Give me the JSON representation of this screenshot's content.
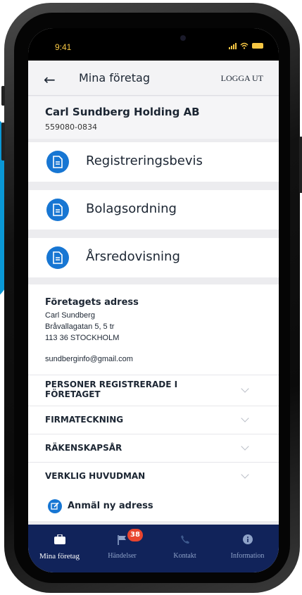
{
  "status_bar": {
    "time": "9:41"
  },
  "header": {
    "title": "Mina företag",
    "logout_label": "LOGGA UT"
  },
  "company": {
    "name": "Carl Sundberg Holding AB",
    "org_number": "559080-0834"
  },
  "documents": [
    {
      "label": "Registreringsbevis",
      "icon": "document-icon"
    },
    {
      "label": "Bolagsordning",
      "icon": "document-icon"
    },
    {
      "label": "Årsredovisning",
      "icon": "document-icon"
    }
  ],
  "address": {
    "heading": "Företagets adress",
    "lines": [
      "Carl Sundberg",
      "Bråvallagatan 5, 5 tr",
      "113 36 STOCKHOLM"
    ],
    "email": "sundberginfo@gmail.com"
  },
  "sections": [
    {
      "label": "PERSONER REGISTRERADE I FÖRETAGET"
    },
    {
      "label": "FIRMATECKNING"
    },
    {
      "label": "RÄKENSKAPSÅR"
    },
    {
      "label": "VERKLIG HUVUDMAN"
    }
  ],
  "new_address": {
    "label": "Anmäl ny adress"
  },
  "tabs": [
    {
      "label": "Mina företag",
      "active": true,
      "icon": "briefcase-icon"
    },
    {
      "label": "Händelser",
      "active": false,
      "icon": "flag-icon",
      "badge": "38"
    },
    {
      "label": "Kontakt",
      "active": false,
      "icon": "phone-icon"
    },
    {
      "label": "Information",
      "active": false,
      "icon": "info-icon"
    }
  ],
  "colors": {
    "accent": "#1776d3",
    "tabbar": "#11235a",
    "badge": "#e8452f",
    "decor_circle": "#0a98d6"
  }
}
